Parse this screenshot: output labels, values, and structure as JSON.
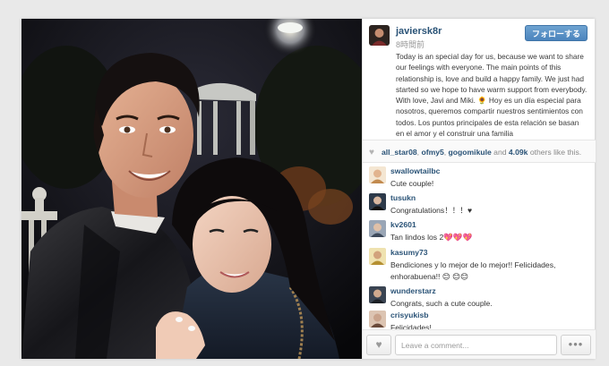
{
  "post": {
    "username": "javiersk8r",
    "time_ago": "8時間前",
    "follow_label": "フォローする",
    "caption": "Today is an special day for us, because we want to share our feelings with everyone. The main points of this relationship is, love and build a happy family. We just had started so we hope to have warm support from everybody. With love, Javi and Miki. 🌻 Hoy es un día especial para nosotros, queremos compartir nuestros sentimientos con todos. Los puntos principales de esta relación se basan en el amor y el construir una familia"
  },
  "likes": {
    "heart_icon": "heart-icon",
    "likers": [
      "all_star08",
      "ofmy5",
      "gogomikule"
    ],
    "and_text": "and",
    "count": "4.09k",
    "suffix": "others like this."
  },
  "comments": [
    {
      "user": "swallowtailbc",
      "text": "Cute couple!",
      "avatar_color": "#e8c9a8"
    },
    {
      "user": "tusukn",
      "text": "Congratulations！！！♥",
      "avatar_color": "#2d3a4a"
    },
    {
      "user": "kv2601",
      "text": "Tan lindos los 2💖💖💖",
      "avatar_color": "#7c8aa0"
    },
    {
      "user": "kasumy73",
      "text": "Bendiciones y lo mejor de lo mejor!! Felicidades, enhorabuena!! 😊 😊😊",
      "avatar_color": "#d8c07a"
    },
    {
      "user": "wunderstarz",
      "text": "Congrats, such a cute couple.",
      "avatar_color": "#3a4452"
    },
    {
      "user": "crisyukisb",
      "text": "Felicidades!",
      "avatar_color": "#c9a38c"
    }
  ],
  "footer": {
    "comment_placeholder": "Leave a comment...",
    "more_label": "•••"
  },
  "colors": {
    "link": "#2a5377",
    "follow_button": "#4b84bd"
  }
}
